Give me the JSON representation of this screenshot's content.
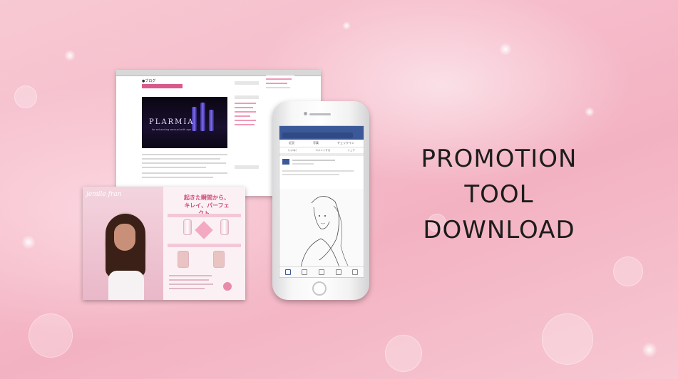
{
  "headline": {
    "line1": "PROMOTION",
    "line2": "TOOL",
    "line3": "DOWNLOAD"
  },
  "website_mockup": {
    "hero_brand": "PLARMIA",
    "hero_tagline": "for enhancing sensual with age"
  },
  "brochure": {
    "brand": "jemile fran",
    "headline_jp_1": "起きた瞬間から、",
    "headline_jp_2": "キレイ、パーフェクト。"
  },
  "phone": {
    "actions": [
      "近況",
      "写真",
      "チェックイン"
    ],
    "post_actions": [
      "いいね！",
      "コメントする",
      "シェア"
    ]
  }
}
